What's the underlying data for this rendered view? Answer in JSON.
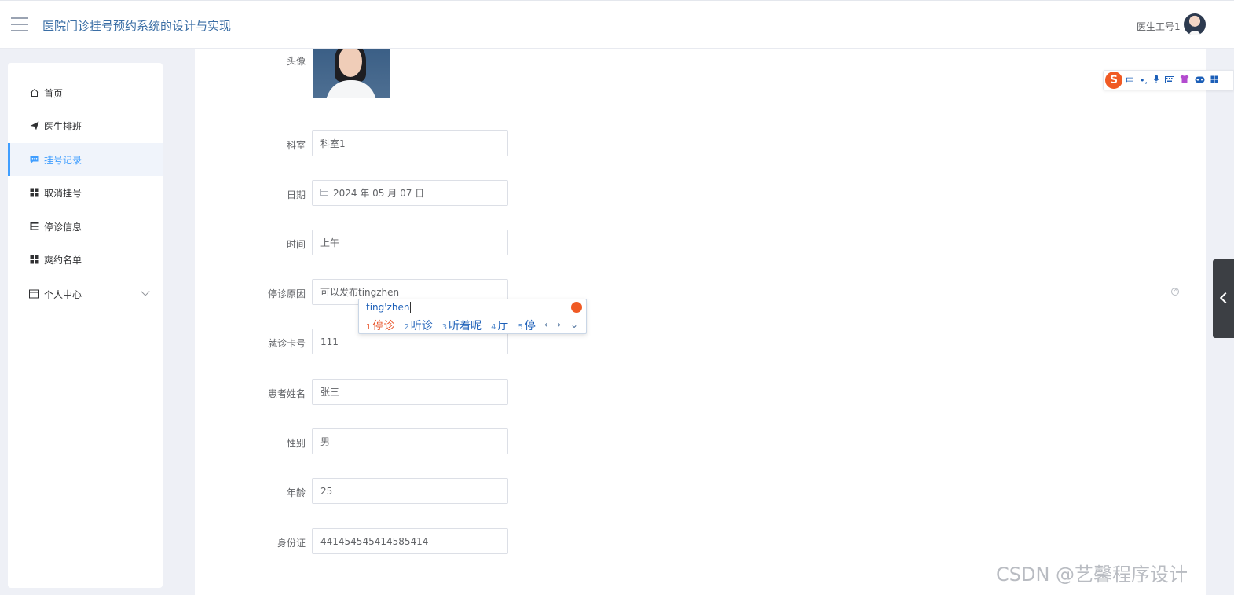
{
  "header": {
    "app_title": "医院门诊挂号预约系统的设计与实现",
    "user_name": "医生工号1"
  },
  "sidebar": {
    "items": [
      {
        "label": "首页",
        "icon": "home-icon"
      },
      {
        "label": "医生排班",
        "icon": "send-icon"
      },
      {
        "label": "挂号记录",
        "icon": "chat-icon",
        "active": true
      },
      {
        "label": "取消挂号",
        "icon": "grid-icon"
      },
      {
        "label": "停诊信息",
        "icon": "list-icon"
      },
      {
        "label": "爽约名单",
        "icon": "grid-icon"
      },
      {
        "label": "个人中心",
        "icon": "card-icon",
        "expandable": true
      }
    ]
  },
  "form": {
    "avatar_label": "头像",
    "fields": [
      {
        "label": "科室",
        "value": "科室1"
      },
      {
        "label": "日期",
        "value": "2024 年 05 月 07 日"
      },
      {
        "label": "时间",
        "value": "上午"
      },
      {
        "label": "停诊原因",
        "value": "可以发布tingzhen"
      },
      {
        "label": "就诊卡号",
        "value": "111"
      },
      {
        "label": "患者姓名",
        "value": "张三"
      },
      {
        "label": "性别",
        "value": "男"
      },
      {
        "label": "年龄",
        "value": "25"
      },
      {
        "label": "身份证",
        "value": "441454545414585414"
      }
    ]
  },
  "ime_toolbar": {
    "logo": "S",
    "mode": "中",
    "punct": "•,"
  },
  "ime": {
    "pinyin": "ting'zhen",
    "candidates": [
      {
        "n": "1",
        "text": "停诊"
      },
      {
        "n": "2",
        "text": "听诊"
      },
      {
        "n": "3",
        "text": "听着呢"
      },
      {
        "n": "4",
        "text": "厅"
      },
      {
        "n": "5",
        "text": "停"
      }
    ],
    "nav": "‹ › ⌄"
  },
  "watermark": "CSDN @艺馨程序设计",
  "colors": {
    "accent": "#409eff",
    "title": "#3a6ea5",
    "ime_first": "#e8552b",
    "ime_blue": "#1c5fb8"
  }
}
